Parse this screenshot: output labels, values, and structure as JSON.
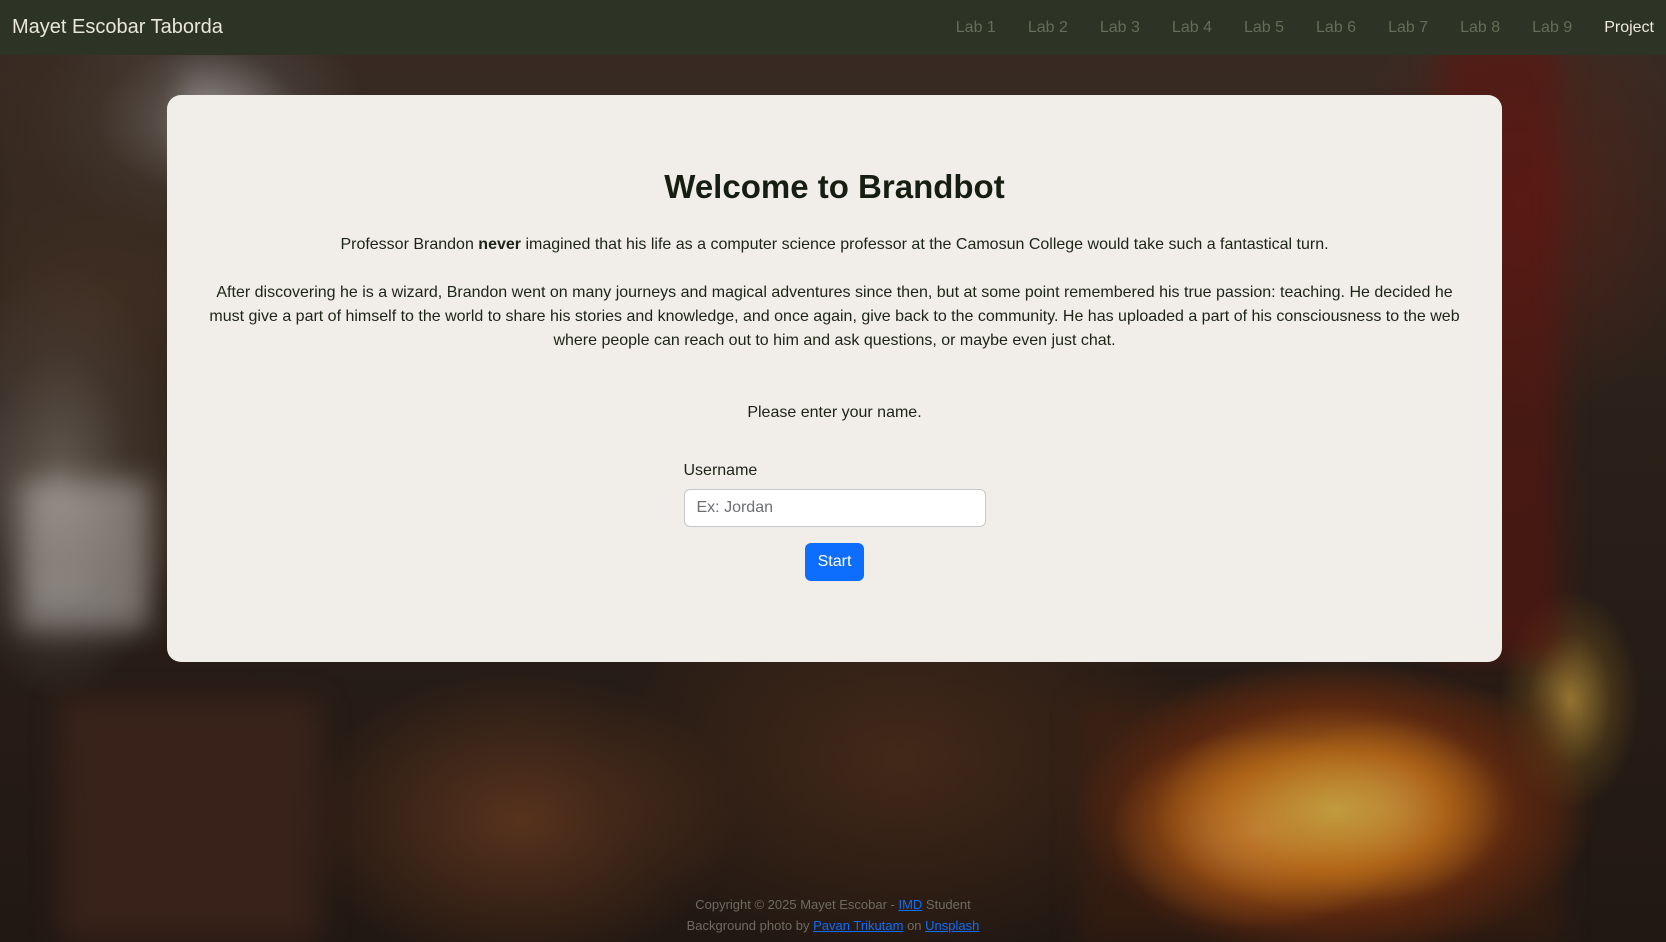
{
  "navbar": {
    "brand": "Mayet Escobar Taborda",
    "links": [
      "Lab 1",
      "Lab 2",
      "Lab 3",
      "Lab 4",
      "Lab 5",
      "Lab 6",
      "Lab 7",
      "Lab 8",
      "Lab 9",
      "Project"
    ],
    "active_link": "Project"
  },
  "main": {
    "title": "Welcome to Brandbot",
    "intro": {
      "before": "Professor Brandon ",
      "bold": "never",
      "after": " imagined that his life as a computer science professor at the Camosun College would take such a fantastical turn."
    },
    "story": "After discovering he is a wizard, Brandon went on many journeys and magical adventures since then, but at some point remembered his true passion: teaching. He decided he must give a part of himself to the world to share his stories and knowledge, and once again, give back to the community. He has uploaded a part of his consciousness to the web where people can reach out to him and ask questions, or maybe even just chat.",
    "prompt": "Please enter your name.",
    "form": {
      "label": "Username",
      "placeholder": "Ex: Jordan",
      "value": "",
      "button": "Start"
    }
  },
  "footer": {
    "line1_prefix": "Copyright © 2025 Mayet Escobar - ",
    "line1_link": "IMD",
    "line1_suffix": " Student",
    "line2_prefix": "Background photo by ",
    "line2_link1": "Pavan Trikutam",
    "line2_mid": " on ",
    "line2_link2": "Unsplash"
  },
  "colors": {
    "navbar_bg": "#2d3425",
    "card_bg": "#f1eee9",
    "button_primary": "#0d6efd",
    "nav_link": "#676b57",
    "nav_link_active": "#eeeae0"
  }
}
